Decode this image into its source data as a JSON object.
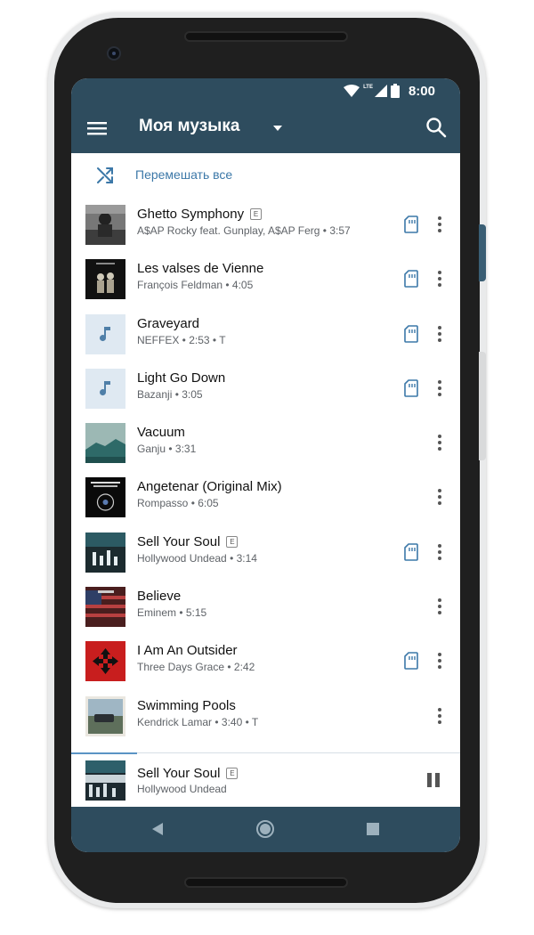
{
  "status_bar": {
    "network": "LTE",
    "time": "8:00"
  },
  "app_bar": {
    "title": "Моя музыка",
    "menu_icon": "hamburger-menu-icon",
    "dropdown_icon": "dropdown-arrow-icon",
    "search_icon": "search-icon",
    "background": "#2e4c5e"
  },
  "shuffle": {
    "label": "Перемешать все",
    "icon": "shuffle-icon",
    "color": "#3c78a8"
  },
  "explicit_badge": "E",
  "tracks": [
    {
      "title": "Ghetto Symphony",
      "subtitle": "A$AP Rocky feat. Gunplay, A$AP Ferg • 3:57",
      "explicit": true,
      "downloaded": true,
      "art": "cover-bw-photo"
    },
    {
      "title": "Les valses de Vienne",
      "subtitle": "François Feldman • 4:05",
      "explicit": false,
      "downloaded": true,
      "art": "cover-dark-couple"
    },
    {
      "title": "Graveyard",
      "subtitle": "NEFFEX • 2:53 • T",
      "explicit": false,
      "downloaded": true,
      "art": "music-note-placeholder"
    },
    {
      "title": "Light Go Down",
      "subtitle": "Bazanji • 3:05",
      "explicit": false,
      "downloaded": true,
      "art": "music-note-placeholder"
    },
    {
      "title": "Vacuum",
      "subtitle": "Ganju • 3:31",
      "explicit": false,
      "downloaded": false,
      "art": "cover-teal-landscape"
    },
    {
      "title": "Angetenar (Original Mix)",
      "subtitle": "Rompasso • 6:05",
      "explicit": false,
      "downloaded": false,
      "art": "cover-black-disc"
    },
    {
      "title": "Sell Your Soul",
      "subtitle": "Hollywood Undead • 3:14",
      "explicit": true,
      "downloaded": true,
      "art": "cover-dark-city"
    },
    {
      "title": "Believe",
      "subtitle": "Eminem • 5:15",
      "explicit": false,
      "downloaded": false,
      "art": "cover-flag"
    },
    {
      "title": "I Am An Outsider",
      "subtitle": "Three Days Grace • 2:42",
      "explicit": false,
      "downloaded": true,
      "art": "cover-red-arrows"
    },
    {
      "title": "Swimming Pools",
      "subtitle": "Kendrick Lamar  • 3:40 • T",
      "explicit": false,
      "downloaded": false,
      "art": "cover-car-photo"
    }
  ],
  "now_playing": {
    "title": "Sell Your Soul",
    "subtitle": "Hollywood Undead",
    "explicit": true,
    "progress": 0.17,
    "pause_icon": "pause-icon"
  },
  "nav_bar": {
    "back_icon": "back-triangle-icon",
    "home_icon": "home-circle-icon",
    "recents_icon": "recents-square-icon"
  },
  "colors": {
    "accent": "#3c78a8",
    "primary_dark": "#2e4c5e",
    "download_icon": "#3c78a8"
  }
}
